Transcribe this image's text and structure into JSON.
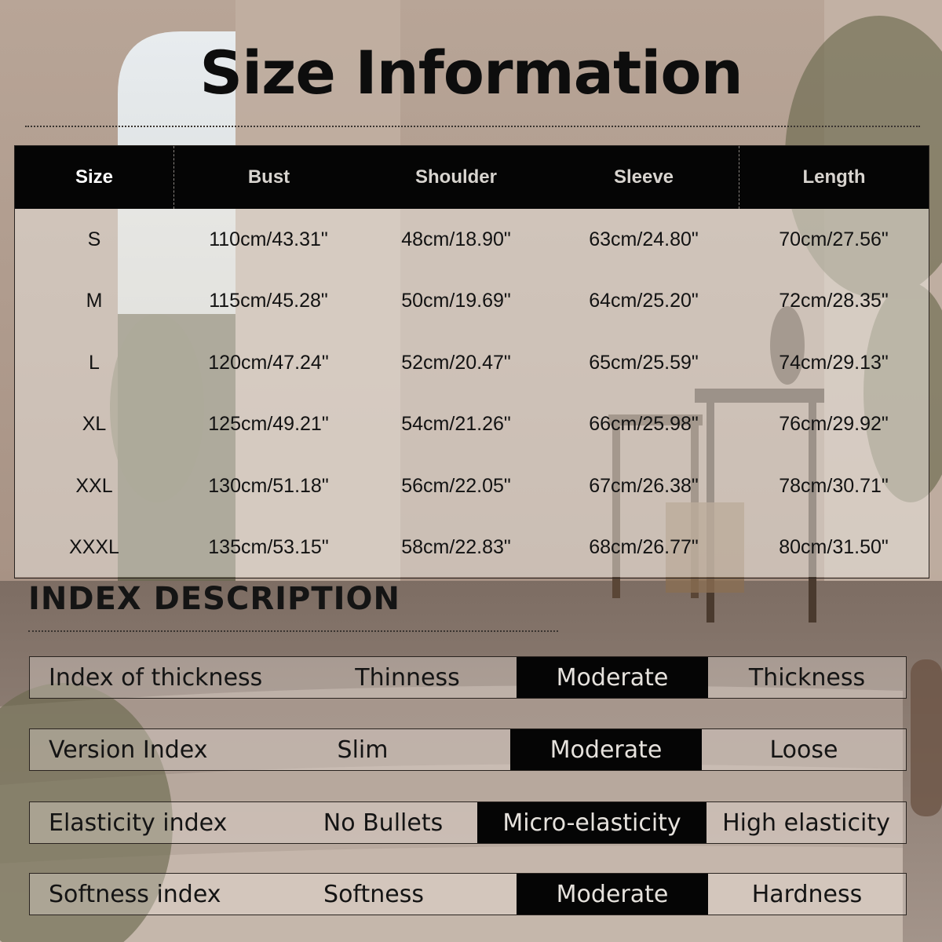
{
  "title": "Size Information",
  "table": {
    "headers": [
      "Size",
      "Bust",
      "Shoulder",
      "Sleeve",
      "Length"
    ],
    "rows": [
      [
        "S",
        "110cm/43.31\"",
        "48cm/18.90\"",
        "63cm/24.80\"",
        "70cm/27.56\""
      ],
      [
        "M",
        "115cm/45.28\"",
        "50cm/19.69\"",
        "64cm/25.20\"",
        "72cm/28.35\""
      ],
      [
        "L",
        "120cm/47.24\"",
        "52cm/20.47\"",
        "65cm/25.59\"",
        "74cm/29.13\""
      ],
      [
        "XL",
        "125cm/49.21\"",
        "54cm/21.26\"",
        "66cm/25.98\"",
        "76cm/29.92\""
      ],
      [
        "XXL",
        "130cm/51.18\"",
        "56cm/22.05\"",
        "67cm/26.38\"",
        "78cm/30.71\""
      ],
      [
        "XXXL",
        "135cm/53.15\"",
        "58cm/22.83\"",
        "68cm/26.77\"",
        "80cm/31.50\""
      ]
    ]
  },
  "index": {
    "heading": "INDEX DESCRIPTION",
    "rows": [
      {
        "label": "Index of thickness",
        "options": [
          "Thinness",
          "Moderate",
          "Thickness"
        ],
        "selected": "Moderate"
      },
      {
        "label": "Version Index",
        "options": [
          "Slim",
          "Moderate",
          "Loose"
        ],
        "selected": "Moderate"
      },
      {
        "label": "Elasticity index",
        "options": [
          "No Bullets",
          "Micro-elasticity",
          "High elasticity"
        ],
        "selected": "Micro-elasticity"
      },
      {
        "label": "Softness index",
        "options": [
          "Softness",
          "Moderate",
          "Hardness"
        ],
        "selected": "Moderate"
      }
    ]
  },
  "colors": {
    "header_bg": "#050505",
    "selected_bg": "#050505",
    "text": "#121212"
  }
}
